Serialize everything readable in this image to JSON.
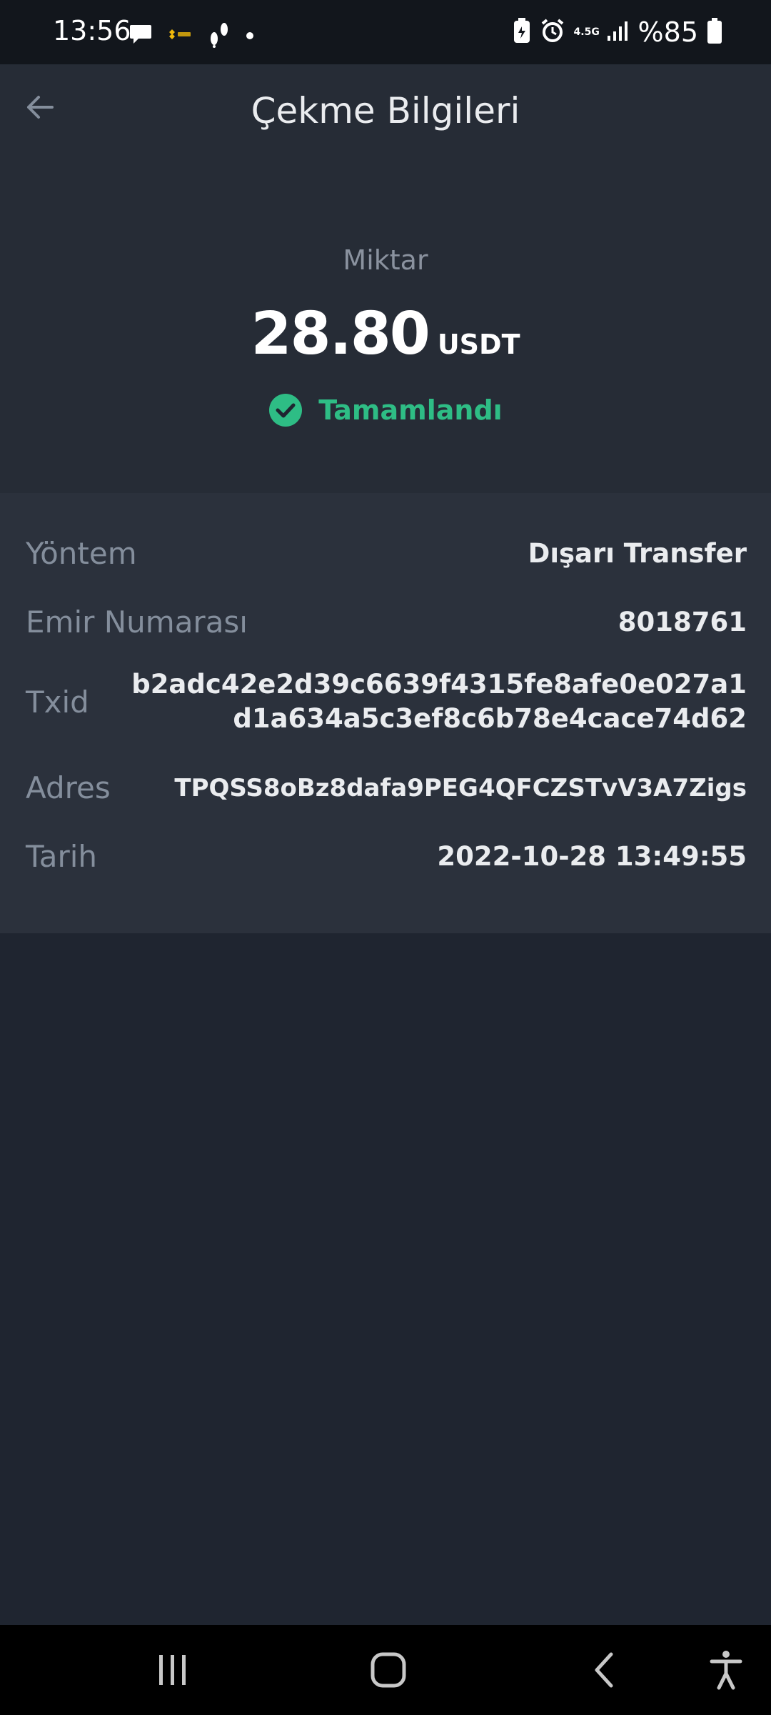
{
  "status_bar": {
    "time": "13:56",
    "network": "4.5G",
    "battery": "%85",
    "icons": [
      "chat-icon",
      "binance-tr-icon",
      "footsteps-icon",
      "dot-icon",
      "battery-saver-icon",
      "alarm-icon",
      "signal-icon",
      "battery-icon"
    ]
  },
  "header": {
    "title": "Çekme Bilgileri",
    "back_icon": "arrow-left-icon"
  },
  "amount": {
    "label": "Miktar",
    "value": "28.80",
    "unit": "USDT",
    "status": "Tamamlandı",
    "status_icon": "check-circle-icon"
  },
  "details": [
    {
      "label": "Yöntem",
      "value": "Dışarı Transfer"
    },
    {
      "label": "Emir Numarası",
      "value": "8018761"
    },
    {
      "label": "Txid",
      "value": "b2adc42e2d39c6639f4315fe8afe0e027a1d1a634a5c3ef8c6b78e4cace74d62"
    },
    {
      "label": "Adres",
      "value": "TPQSS8oBz8dafa9PEG4QFCZSTvV3A7Zigs"
    },
    {
      "label": "Tarih",
      "value": "2022-10-28 13:49:55"
    }
  ],
  "nav_bar": {
    "items": [
      "recents-icon",
      "home-icon",
      "back-icon",
      "accessibility-icon"
    ]
  },
  "colors": {
    "background": "#1f2530",
    "card": "#262c36",
    "details_bg": "#2b313c",
    "success": "#2ebd85",
    "muted": "#848e9c"
  }
}
